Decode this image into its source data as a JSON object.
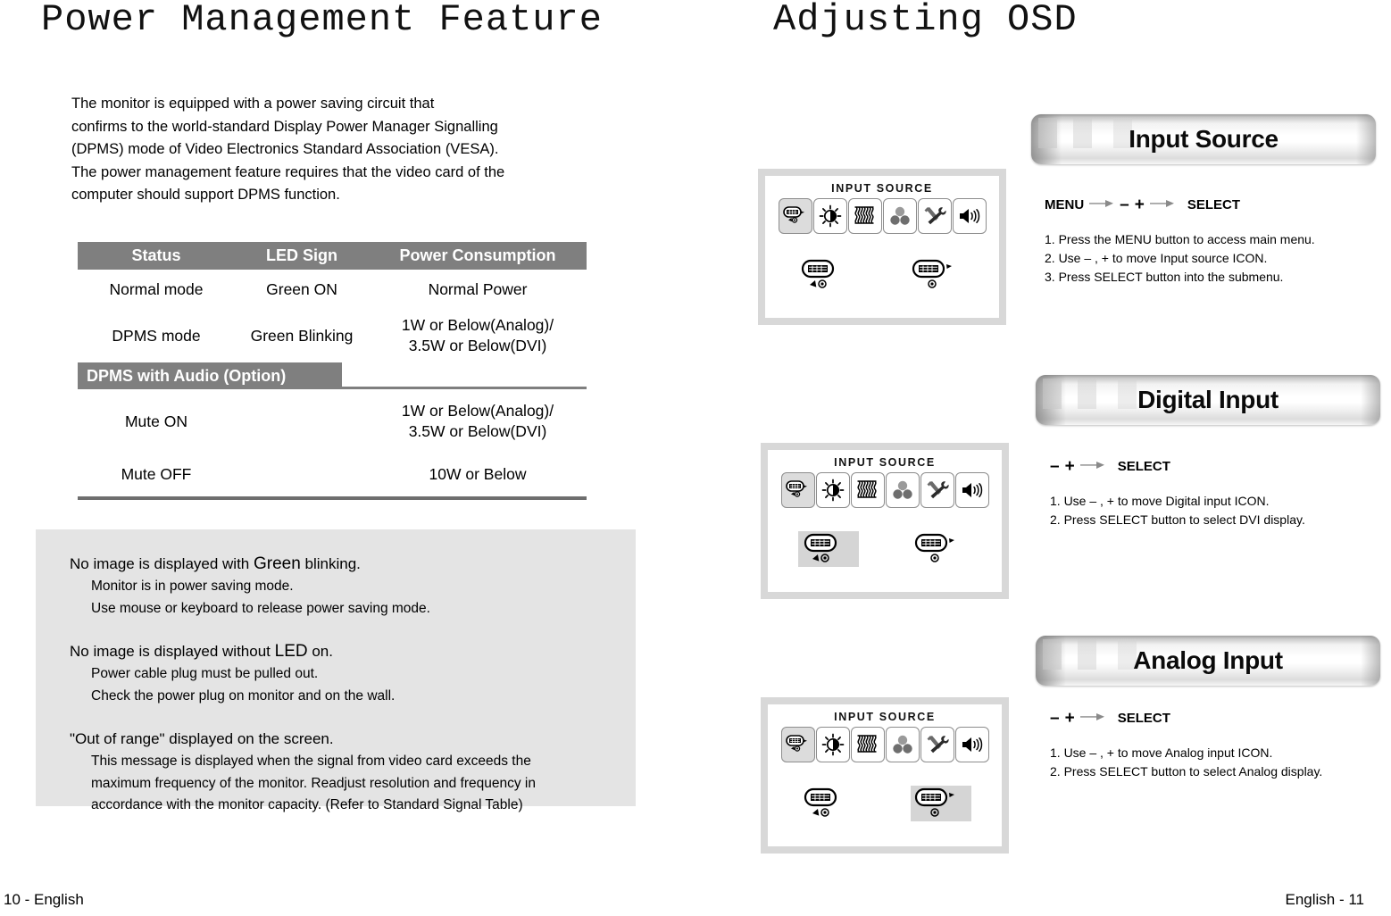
{
  "titles": {
    "left": "Power Management Feature",
    "right": "Adjusting OSD"
  },
  "intro": {
    "lines": [
      "The monitor is equipped with a power saving circuit that",
      "confirms to the world-standard Display Power Manager Signalling",
      "(DPMS) mode of Video Electronics Standard Association (VESA).",
      "The power management feature requires that the video card of the",
      "computer should support DPMS function."
    ]
  },
  "table": {
    "headers": [
      "Status",
      "LED Sign",
      "Power Consumption"
    ],
    "rows": [
      {
        "status": "Normal mode",
        "led": "Green ON",
        "power_line1": "Normal Power",
        "power_line2": ""
      },
      {
        "status": "DPMS mode",
        "led": "Green Blinking",
        "power_line1": "1W or Below(Analog)/",
        "power_line2": "3.5W or Below(DVI)"
      }
    ],
    "subheader": "DPMS with Audio (Option)",
    "audio_rows": [
      {
        "status": "Mute ON",
        "led": "",
        "power_line1": "1W or Below(Analog)/",
        "power_line2": "3.5W or Below(DVI)"
      },
      {
        "status": "Mute OFF",
        "led": "",
        "power_line1": "10W or Below",
        "power_line2": ""
      }
    ]
  },
  "note": {
    "blocks": [
      {
        "head_pre": "No image is displayed with ",
        "head_big": "Green",
        "head_post": " blinking.",
        "items": [
          "Monitor is in power saving mode.",
          "Use mouse or keyboard to release power saving mode."
        ]
      },
      {
        "head_pre": "No image is displayed without ",
        "head_big": "LED",
        "head_post": " on.",
        "items": [
          "Power cable plug must be pulled out.",
          "Check the power plug on monitor and on the wall."
        ]
      },
      {
        "head_pre": "\"Out of range\" displayed on the screen.",
        "head_big": "",
        "head_post": "",
        "items": [
          "This message is displayed when the signal from video card exceeds the",
          "maximum frequency of the monitor. Readjust resolution and frequency in",
          "accordance with the monitor capacity. (Refer to Standard Signal Table)"
        ]
      }
    ]
  },
  "osd_panels": [
    {
      "label": "INPUT SOURCE",
      "icons": [
        "input-source-icon",
        "brightness-contrast-icon",
        "geometry-icon",
        "color-icon",
        "tools-icon",
        "volume-icon"
      ],
      "selected_icon_index": 0,
      "sub_icons": [
        "digital-dvi-connector-icon",
        "analog-vga-connector-icon"
      ],
      "selected_sub_index": -1
    },
    {
      "label": "INPUT SOURCE",
      "icons": [
        "input-source-icon",
        "brightness-contrast-icon",
        "geometry-icon",
        "color-icon",
        "tools-icon",
        "volume-icon"
      ],
      "selected_icon_index": 0,
      "sub_icons": [
        "digital-dvi-connector-icon",
        "analog-vga-connector-icon"
      ],
      "selected_sub_index": 0
    },
    {
      "label": "INPUT SOURCE",
      "icons": [
        "input-source-icon",
        "brightness-contrast-icon",
        "geometry-icon",
        "color-icon",
        "tools-icon",
        "volume-icon"
      ],
      "selected_icon_index": 0,
      "sub_icons": [
        "digital-dvi-connector-icon",
        "analog-vga-connector-icon"
      ],
      "selected_sub_index": 1
    }
  ],
  "sections": [
    {
      "banner": "Input Source",
      "keys": {
        "menu": "MENU",
        "minus": "–",
        "plus": "+",
        "select": "SELECT",
        "show_menu": true
      },
      "steps": [
        "1. Press the MENU button to access main menu.",
        "2. Use  – , + to move Input source ICON.",
        "3. Press SELECT button into the submenu."
      ]
    },
    {
      "banner": "Digital Input",
      "keys": {
        "menu": "",
        "minus": "–",
        "plus": "+",
        "select": "SELECT",
        "show_menu": false
      },
      "steps": [
        "1. Use  – , + to move Digital input ICON.",
        "2. Press SELECT button to select DVI display."
      ]
    },
    {
      "banner": "Analog Input",
      "keys": {
        "menu": "",
        "minus": "–",
        "plus": "+",
        "select": "SELECT",
        "show_menu": false
      },
      "steps": [
        "1. Use  – , + to move Analog input ICON.",
        "2. Press SELECT button to select Analog display."
      ]
    }
  ],
  "footers": {
    "left": "10 - English",
    "right": "English - 11"
  },
  "colors": {
    "table_header_bg": "#7f7f7f",
    "note_bg": "#e4e4e4",
    "panel_frame": "#d8d8d8",
    "selection": "#dcdcdc"
  }
}
